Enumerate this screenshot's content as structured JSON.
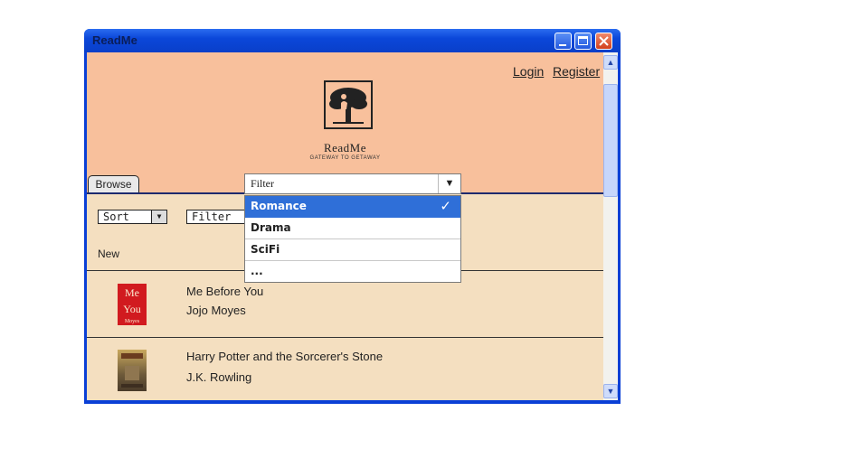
{
  "window": {
    "title": "ReadMe"
  },
  "header": {
    "login": "Login",
    "register": "Register",
    "logo_name": "ReadMe",
    "logo_tagline": "GATEWAY TO GETAWAY"
  },
  "tabs": {
    "browse": "Browse"
  },
  "toolbar": {
    "sort_label": "Sort",
    "filter_label": "Filter"
  },
  "section": {
    "new_label": "New"
  },
  "books": [
    {
      "title": "Me Before You",
      "author": "Jojo Moyes"
    },
    {
      "title": "Harry Potter and the Sorcerer's Stone",
      "author": "J.K. Rowling"
    }
  ],
  "dropdown": {
    "value": "Filter",
    "options": [
      "Romance",
      "Drama",
      "SciFi",
      "..."
    ],
    "selected": "Romance",
    "check": "✓"
  },
  "colors": {
    "header": "#f8c09c",
    "body": "#f4dfc0",
    "selection": "#2f6fd8",
    "titlebar": "#0b47d9"
  }
}
